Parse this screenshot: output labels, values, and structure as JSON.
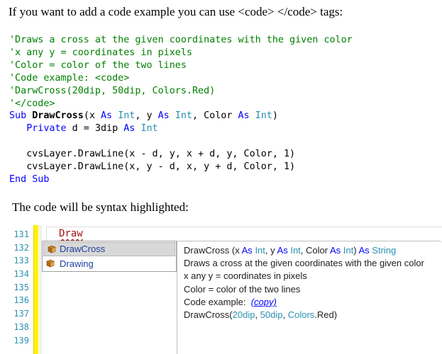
{
  "intro": "If you want to add a code example you can use <code> </code> tags:",
  "code": {
    "comment1": "'Draws a cross at the given coordinates with the given color",
    "comment2": "'x any y = coordinates in pixels",
    "comment3": "'Color = color of the two lines",
    "comment4": "'Code example: <code>",
    "comment5": "'DarwCross(20dip, 50dip, Colors.Red)",
    "comment6": "'</code>",
    "sub_kw": "Sub",
    "sub_name": "DrawCross",
    "p_open": "(x ",
    "as": "As",
    "int": "Int",
    "p_y": ", y ",
    "p_color": ", Color ",
    "p_close": ")",
    "private_kw": "Private",
    "d_eq": " d = 3dip ",
    "line_draw1": "cvsLayer.DrawLine(x - d, y, x + d, y, Color, 1)",
    "line_draw2": "cvsLayer.DrawLine(x, y - d, x, y + d, Color, 1)",
    "end_sub": "End Sub"
  },
  "outro": "The code will be syntax highlighted:",
  "editor": {
    "line_numbers": [
      "131",
      "132",
      "133",
      "134",
      "135",
      "136",
      "137",
      "138",
      "139"
    ],
    "typed_text": "Draw",
    "autocomplete": [
      {
        "label": "DrawCross",
        "icon": "method-icon",
        "selected": true
      },
      {
        "label": "Drawing",
        "icon": "method-icon",
        "selected": false
      }
    ],
    "tooltip": {
      "sig_name": "DrawCross",
      "sig_open": " (x ",
      "as": "As",
      "int": "Int",
      "sig_y": ", y ",
      "sig_color": ", Color ",
      "sig_close": ") ",
      "string": "String",
      "line2": "Draws a cross at the given coordinates with the given color",
      "line3": "x any y = coordinates in pixels",
      "line4": "Color = color of the two lines",
      "line5_label": "Code example:",
      "copy_link": "(copy)",
      "ex_fn": "DrawCross(",
      "ex_a": "20dip",
      "ex_b": "50dip",
      "ex_c": "Colors",
      "ex_d": ".Red)",
      "ex_sep": ", "
    }
  }
}
